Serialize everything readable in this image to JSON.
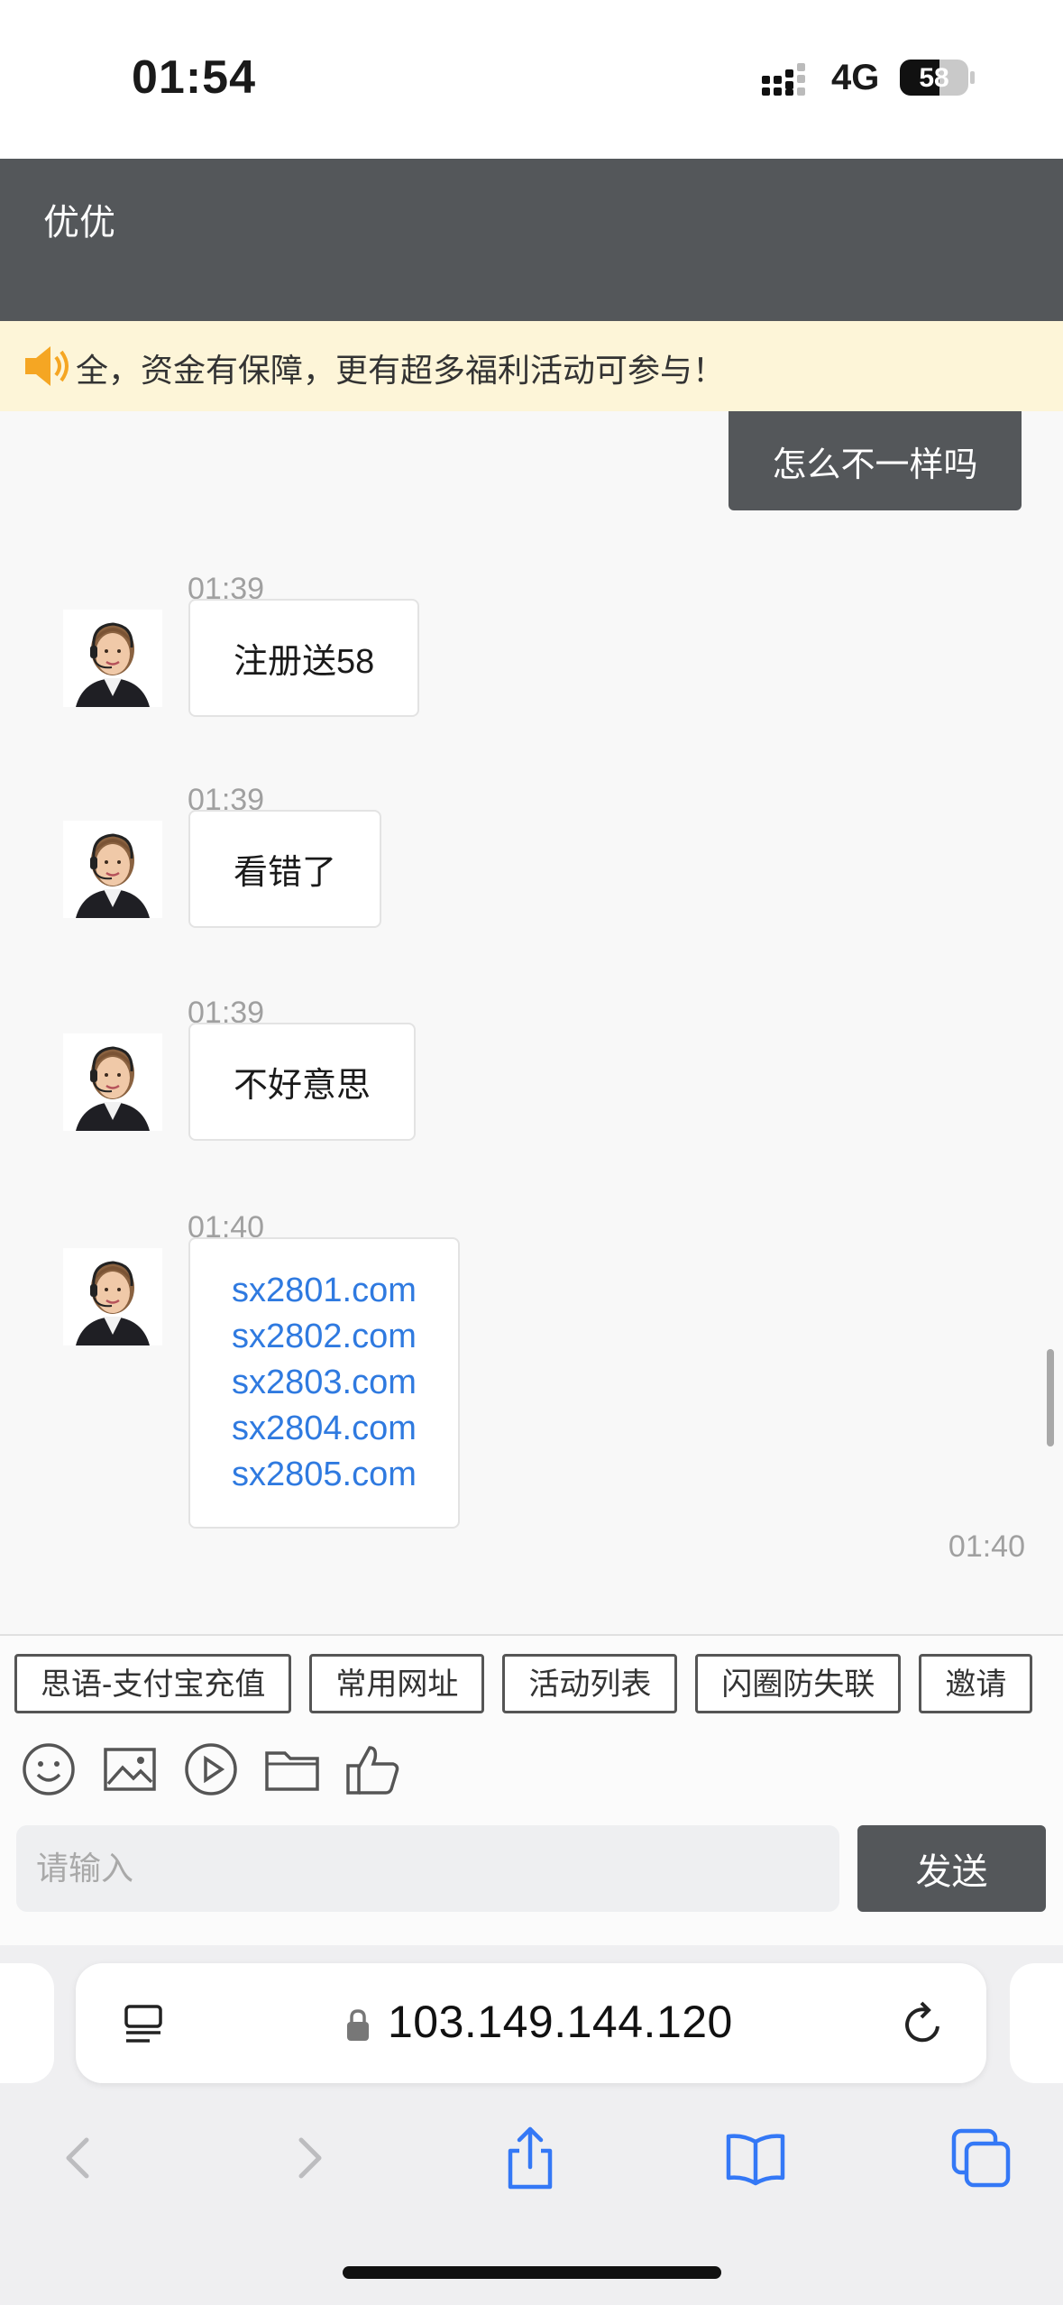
{
  "status_bar": {
    "time": "01:54",
    "network": "4G",
    "battery": "58"
  },
  "header": {
    "title": "优优"
  },
  "notice": {
    "text": "全，资金有保障，更有超多福利活动可参与！"
  },
  "chat": {
    "self_message": "怎么不一样吗",
    "messages": [
      {
        "time": "01:39",
        "text": "注册送58"
      },
      {
        "time": "01:39",
        "text": "看错了"
      },
      {
        "time": "01:39",
        "text": "不好意思"
      },
      {
        "time": "01:40",
        "links": [
          "sx2801.com",
          "sx2802.com",
          "sx2803.com",
          "sx2804.com",
          "sx2805.com"
        ]
      }
    ],
    "end_time": "01:40"
  },
  "quick_replies": [
    "思语-支付宝充值",
    "常用网址",
    "活动列表",
    "闪圈防失联",
    "邀请"
  ],
  "toolbar": {
    "icons": [
      "emoji-icon",
      "image-icon",
      "video-icon",
      "folder-icon",
      "thumbs-up-icon"
    ]
  },
  "composer": {
    "placeholder": "请输入",
    "send_label": "发送"
  },
  "browser": {
    "url": "103.149.144.120"
  },
  "colors": {
    "header_bg": "#54575a",
    "notice_bg": "#fdf5d8",
    "link": "#2f7ae0",
    "safari_blue": "#3478f6"
  }
}
